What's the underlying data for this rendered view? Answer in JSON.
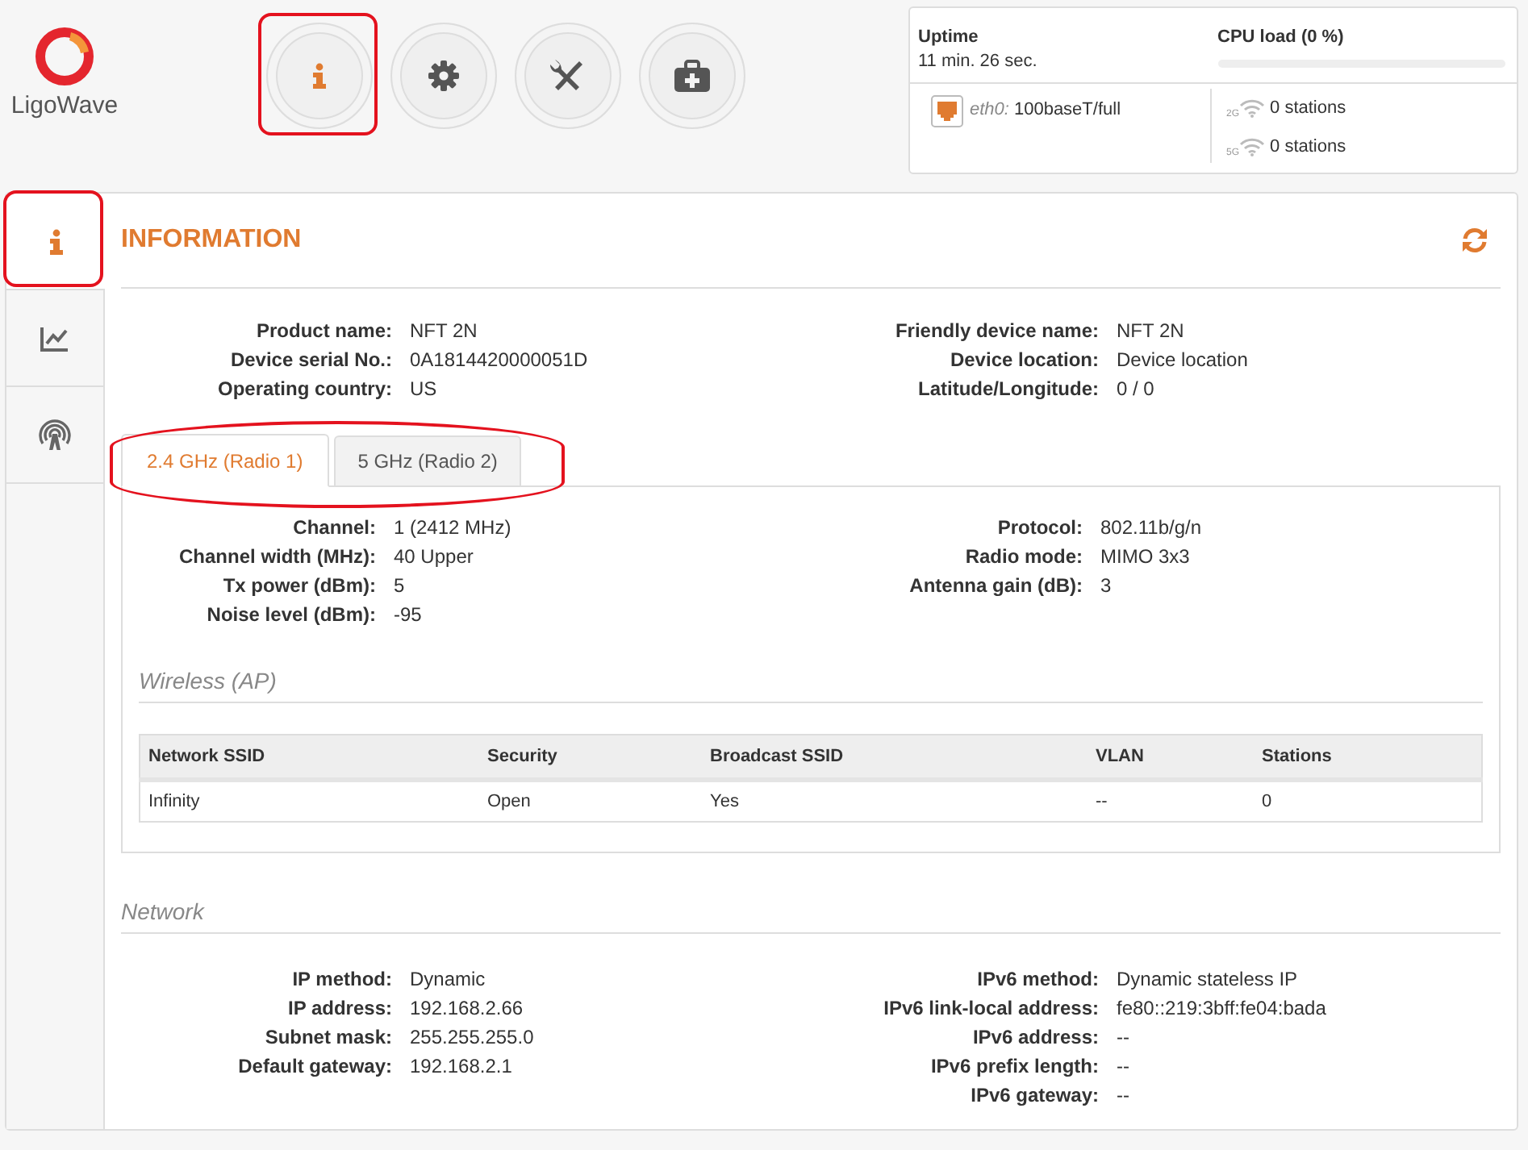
{
  "brand": {
    "name": "LigoWave"
  },
  "nav_buttons": [
    {
      "kind": "info",
      "selected": true,
      "highlighted": true
    },
    {
      "kind": "settings",
      "selected": false,
      "highlighted": false
    },
    {
      "kind": "tools",
      "selected": false,
      "highlighted": false
    },
    {
      "kind": "support",
      "selected": false,
      "highlighted": false
    }
  ],
  "status": {
    "uptime_label": "Uptime",
    "uptime": "11 min. 26 sec.",
    "cpu_label": "CPU load (0 %)",
    "cpu": {
      "level": 0
    },
    "ethernet": {
      "port": "eth0:",
      "value": "100baseT/full"
    },
    "wireless": [
      {
        "band": "2G",
        "stations": "0 stations"
      },
      {
        "band": "5G",
        "stations": "0 stations"
      }
    ]
  },
  "sidebar": {
    "items": [
      {
        "kind": "info",
        "selected": true,
        "highlighted": true
      },
      {
        "kind": "chart",
        "selected": false,
        "highlighted": false
      },
      {
        "kind": "antenna",
        "selected": false,
        "highlighted": false
      }
    ]
  },
  "panel": {
    "title": "INFORMATION",
    "device_info": {
      "left": [
        {
          "label": "Product name:",
          "value": "NFT 2N"
        },
        {
          "label": "Device serial No.:",
          "value": "0A1814420000051D"
        },
        {
          "label": "Operating country:",
          "value": "US"
        }
      ],
      "right": [
        {
          "label": "Friendly device name:",
          "value": "NFT 2N"
        },
        {
          "label": "Device location:",
          "value": "Device location"
        },
        {
          "label": "Latitude/Longitude:",
          "value": "0 / 0"
        }
      ]
    },
    "radio_tabs": {
      "highlighted": true,
      "tabs": [
        {
          "label": "2.4 GHz (Radio 1)",
          "selected": true
        },
        {
          "label": "5 GHz (Radio 2)",
          "selected": false
        }
      ]
    },
    "radio_info": {
      "left": [
        {
          "label": "Channel:",
          "value": "1 (2412 MHz)"
        },
        {
          "label": "Channel width (MHz):",
          "value": "40 Upper"
        },
        {
          "label": "Tx power (dBm):",
          "value": "5"
        },
        {
          "label": "Noise level (dBm):",
          "value": "-95"
        }
      ],
      "right": [
        {
          "label": "Protocol:",
          "value": "802.11b/g/n"
        },
        {
          "label": "Radio mode:",
          "value": "MIMO 3x3"
        },
        {
          "label": "Antenna gain (dB):",
          "value": "3"
        }
      ]
    },
    "wireless": {
      "title": "Wireless (AP)",
      "table": {
        "columns": [
          "Network SSID",
          "Security",
          "Broadcast SSID",
          "VLAN",
          "Stations"
        ],
        "rows": [
          [
            "Infinity",
            "Open",
            "Yes",
            "--",
            "0"
          ]
        ]
      }
    },
    "network": {
      "title": "Network",
      "left": [
        {
          "label": "IP method:",
          "value": "Dynamic"
        },
        {
          "label": "IP address:",
          "value": "192.168.2.66"
        },
        {
          "label": "Subnet mask:",
          "value": "255.255.255.0"
        },
        {
          "label": "Default gateway:",
          "value": "192.168.2.1"
        }
      ],
      "right": [
        {
          "label": "IPv6 method:",
          "value": "Dynamic stateless IP"
        },
        {
          "label": "IPv6 link-local address:",
          "value": "fe80::219:3bff:fe04:bada"
        },
        {
          "label": "IPv6 address:",
          "value": "--"
        },
        {
          "label": "IPv6 prefix length:",
          "value": "--"
        },
        {
          "label": "IPv6 gateway:",
          "value": "--"
        }
      ]
    }
  }
}
